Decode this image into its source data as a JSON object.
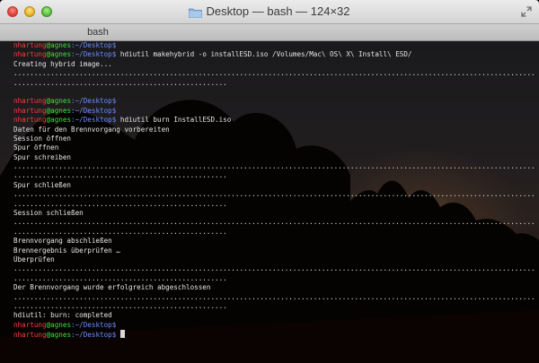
{
  "window": {
    "title": "Desktop — bash — 124×32",
    "title_icon": "folder-icon",
    "tab_label": "bash"
  },
  "colors": {
    "prompt_user": "#ff3b3b",
    "prompt_host": "#3ce03c",
    "prompt_path": "#6a8cff",
    "text": "#e6e6e6"
  },
  "terminal": {
    "prompt": {
      "user": "nhartung",
      "at": "@",
      "host": "agnes",
      "path": ":~/Desktop",
      "symbol": "$"
    },
    "lines": [
      {
        "type": "prompt",
        "cmd": ""
      },
      {
        "type": "prompt",
        "cmd": " hdiutil makehybrid -o installESD.iso /Volumes/Mac\\ OS\\ X\\ Install\\ ESD/"
      },
      {
        "type": "text",
        "text": "Creating hybrid image..."
      },
      {
        "type": "text",
        "text": "......................................................................................................................................"
      },
      {
        "type": "text",
        "text": "...................................................."
      },
      {
        "type": "text",
        "text": ""
      },
      {
        "type": "prompt",
        "cmd": ""
      },
      {
        "type": "prompt",
        "cmd": ""
      },
      {
        "type": "prompt",
        "cmd": " hdiutil burn InstallESD.iso"
      },
      {
        "type": "text",
        "text": "Daten für den Brennvorgang vorbereiten"
      },
      {
        "type": "text",
        "text": "Session öffnen"
      },
      {
        "type": "text",
        "text": "Spur öffnen"
      },
      {
        "type": "text",
        "text": "Spur schreiben"
      },
      {
        "type": "text",
        "text": "......................................................................................................................................"
      },
      {
        "type": "text",
        "text": "...................................................."
      },
      {
        "type": "text",
        "text": "Spur schließen"
      },
      {
        "type": "text",
        "text": "......................................................................................................................................"
      },
      {
        "type": "text",
        "text": "...................................................."
      },
      {
        "type": "text",
        "text": "Session schließen"
      },
      {
        "type": "text",
        "text": "......................................................................................................................................"
      },
      {
        "type": "text",
        "text": "...................................................."
      },
      {
        "type": "text",
        "text": "Brennvorgang abschließen"
      },
      {
        "type": "text",
        "text": "Brennergebnis überprüfen …"
      },
      {
        "type": "text",
        "text": "Überprüfen"
      },
      {
        "type": "text",
        "text": "......................................................................................................................................"
      },
      {
        "type": "text",
        "text": "...................................................."
      },
      {
        "type": "text",
        "text": "Der Brennvorgang wurde erfolgreich abgeschlossen"
      },
      {
        "type": "text",
        "text": "......................................................................................................................................"
      },
      {
        "type": "text",
        "text": "...................................................."
      },
      {
        "type": "text",
        "text": "hdiutil: burn: completed"
      },
      {
        "type": "prompt",
        "cmd": ""
      },
      {
        "type": "prompt",
        "cmd": " ",
        "cursor": true
      }
    ]
  }
}
